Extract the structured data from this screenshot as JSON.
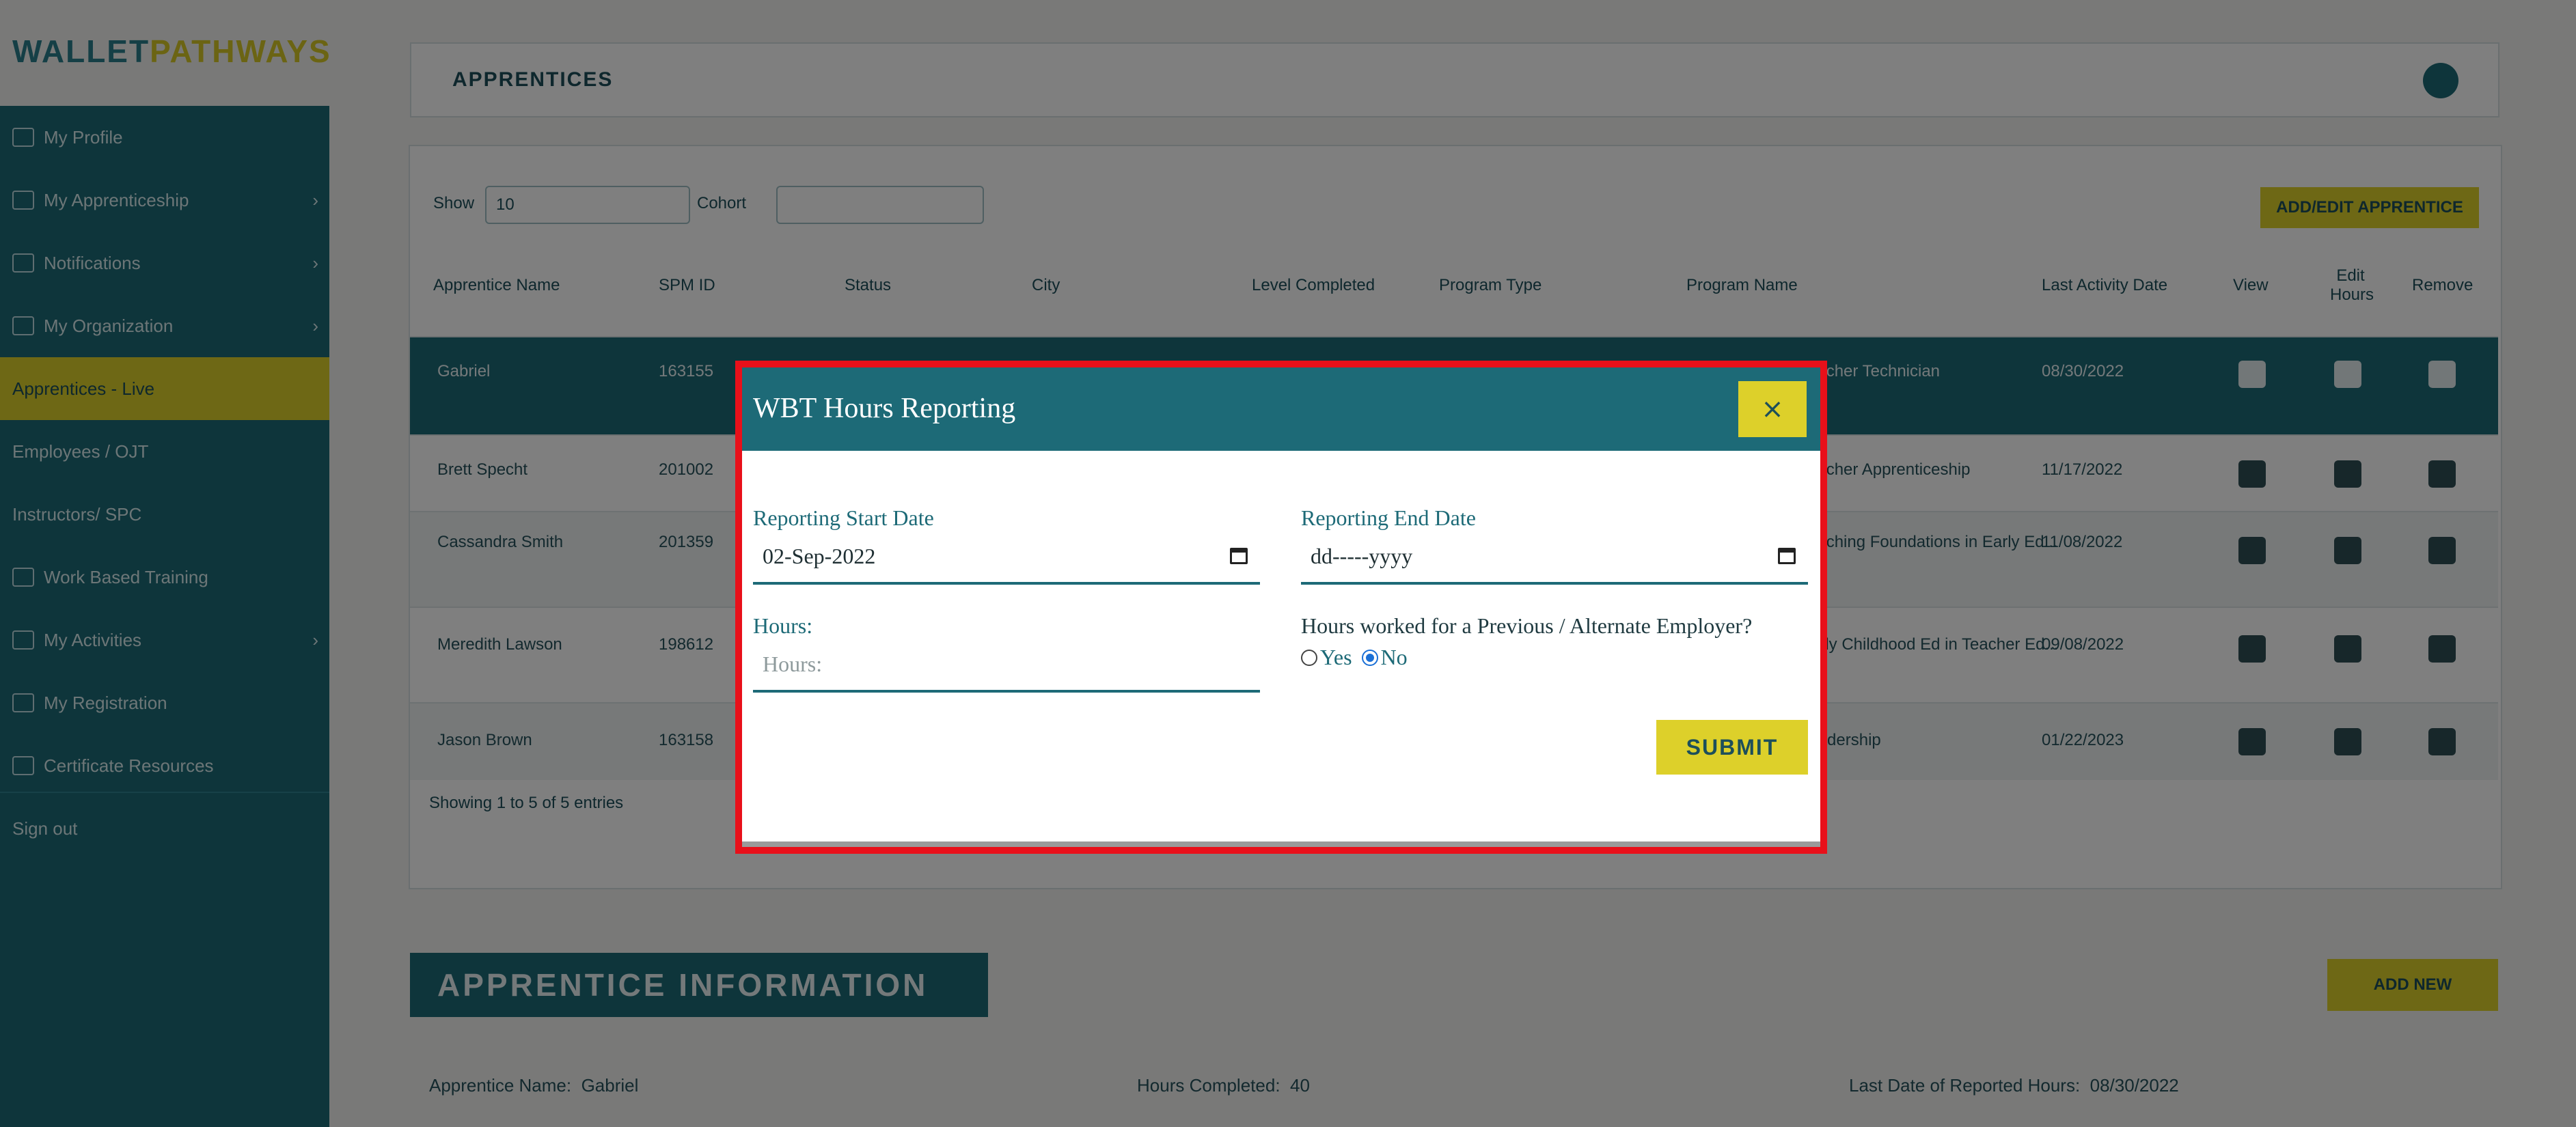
{
  "app": {
    "logo": {
      "part1": "WALLET",
      "part2": "PATHWAYS"
    },
    "header_title": "APPRENTICES",
    "colors": {
      "primary": "#1d6a77",
      "accent": "#ddd02a",
      "highlight_frame": "#e8101a"
    }
  },
  "sidebar": {
    "items": [
      {
        "label": "My Profile",
        "icon": "user-icon"
      },
      {
        "label": "My Apprenticeship",
        "icon": "briefcase-icon",
        "chevron": "›"
      },
      {
        "label": "Notifications",
        "icon": "bell-icon",
        "chevron": "›"
      },
      {
        "label": "My Organization",
        "icon": "building-icon",
        "chevron": "›"
      },
      {
        "label": "Apprentices - Live"
      },
      {
        "label": "Employees / OJT"
      },
      {
        "label": "Instructors/ SPC"
      },
      {
        "label": "Work Based Training",
        "icon": "training-icon"
      },
      {
        "label": "My Activities",
        "icon": "activity-icon",
        "chevron": "›"
      },
      {
        "label": "My Registration",
        "icon": "registration-icon"
      },
      {
        "label": "Certificate Resources",
        "icon": "certificate-icon"
      },
      {
        "label": "Sign out"
      }
    ]
  },
  "table": {
    "show_label": "Show",
    "show_value": "10",
    "cohort_label": "Cohort",
    "action_button": "ADD/EDIT APPRENTICE",
    "headers": [
      "Apprentice Name",
      "SPM ID",
      "Status",
      "City",
      "Level Completed",
      "Program Type",
      "Program Name",
      "Last Activity Date",
      "View",
      "Edit Hours",
      "Remove"
    ],
    "rows": [
      [
        "Gabriel",
        "163155",
        "",
        "",
        "",
        "",
        "Teacher Technician",
        "08/30/2022"
      ],
      [
        "Brett Specht",
        "201002",
        "",
        "",
        "",
        "",
        "Teacher Apprenticeship",
        "11/17/2022"
      ],
      [
        "Cassandra Smith",
        "201359",
        "",
        "",
        "",
        "",
        "Teaching Foundations in Early Ed...",
        "11/08/2022"
      ],
      [
        "Meredith Lawson",
        "198612",
        "",
        "",
        "",
        "",
        "Early Childhood Ed in Teacher Ed...",
        "09/08/2022"
      ],
      [
        "Jason Brown",
        "163158",
        "",
        "",
        "",
        "",
        "Leadership",
        "01/22/2023"
      ]
    ],
    "footer_text": "Showing 1 to 5 of 5 entries"
  },
  "section": {
    "title": "APPRENTICE INFORMATION",
    "add_button": "ADD NEW",
    "fields": [
      {
        "label": "Apprentice Name:",
        "value": "Gabriel"
      },
      {
        "label": "Hours Completed:",
        "value": "40"
      },
      {
        "label": "Last Date of Reported Hours:",
        "value": "08/30/2022"
      }
    ]
  },
  "modal": {
    "title": "WBT Hours Reporting",
    "close_symbol": "×",
    "start_date_label": "Reporting Start Date",
    "start_date_value": "02-Sep-2022",
    "end_date_label": "Reporting End Date",
    "end_date_placeholder": "dd-----yyyy",
    "hours_label": "Hours:",
    "hours_placeholder": "Hours:",
    "employer_question": "Hours worked for a Previous / Alternate Employer?",
    "employer_options": [
      {
        "label": "Yes",
        "selected": false
      },
      {
        "label": "No",
        "selected": true
      }
    ],
    "submit_label": "SUBMIT"
  }
}
